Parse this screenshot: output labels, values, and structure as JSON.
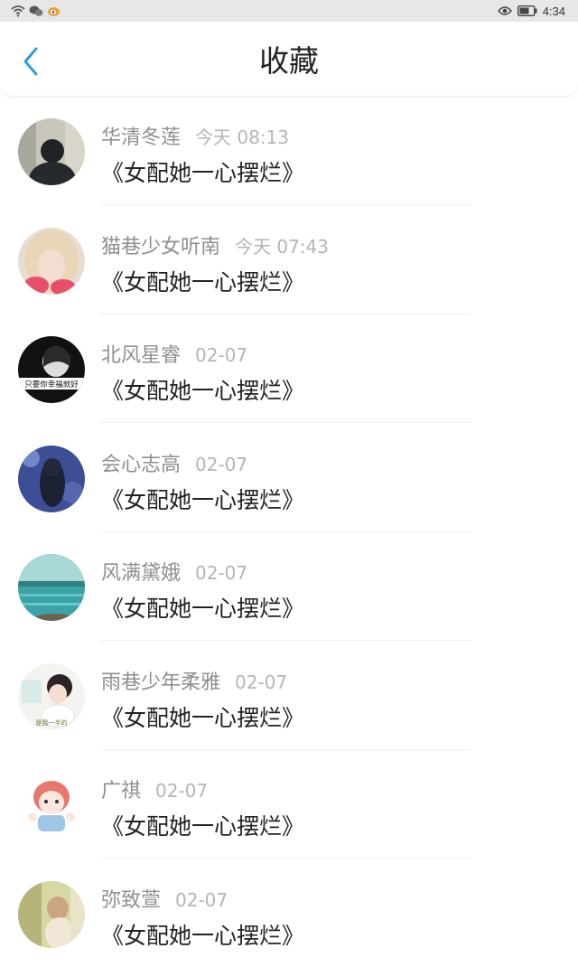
{
  "status_bar": {
    "time": "4:34"
  },
  "header": {
    "title": "收藏"
  },
  "items": [
    {
      "name": "华清冬莲",
      "time": "今天 08:13",
      "book": "《女配她一心摆烂》"
    },
    {
      "name": "猫巷少女听南",
      "time": "今天 07:43",
      "book": "《女配她一心摆烂》"
    },
    {
      "name": "北风星睿",
      "time": "02-07",
      "book": "《女配她一心摆烂》",
      "avatar_caption": "只要你幸福就好"
    },
    {
      "name": "会心志高",
      "time": "02-07",
      "book": "《女配她一心摆烂》"
    },
    {
      "name": "风满黛娥",
      "time": "02-07",
      "book": "《女配她一心摆烂》"
    },
    {
      "name": "雨巷少年柔雅",
      "time": "02-07",
      "book": "《女配她一心摆烂》",
      "avatar_caption": "是我一半的"
    },
    {
      "name": "广祺",
      "time": "02-07",
      "book": "《女配她一心摆烂》"
    },
    {
      "name": "弥致萱",
      "time": "02-07",
      "book": "《女配她一心摆烂》"
    }
  ],
  "colors": {
    "accent": "#2f9be8",
    "title": "#222222",
    "username": "#8f8f8f",
    "timestamp": "#b5b5b5"
  }
}
